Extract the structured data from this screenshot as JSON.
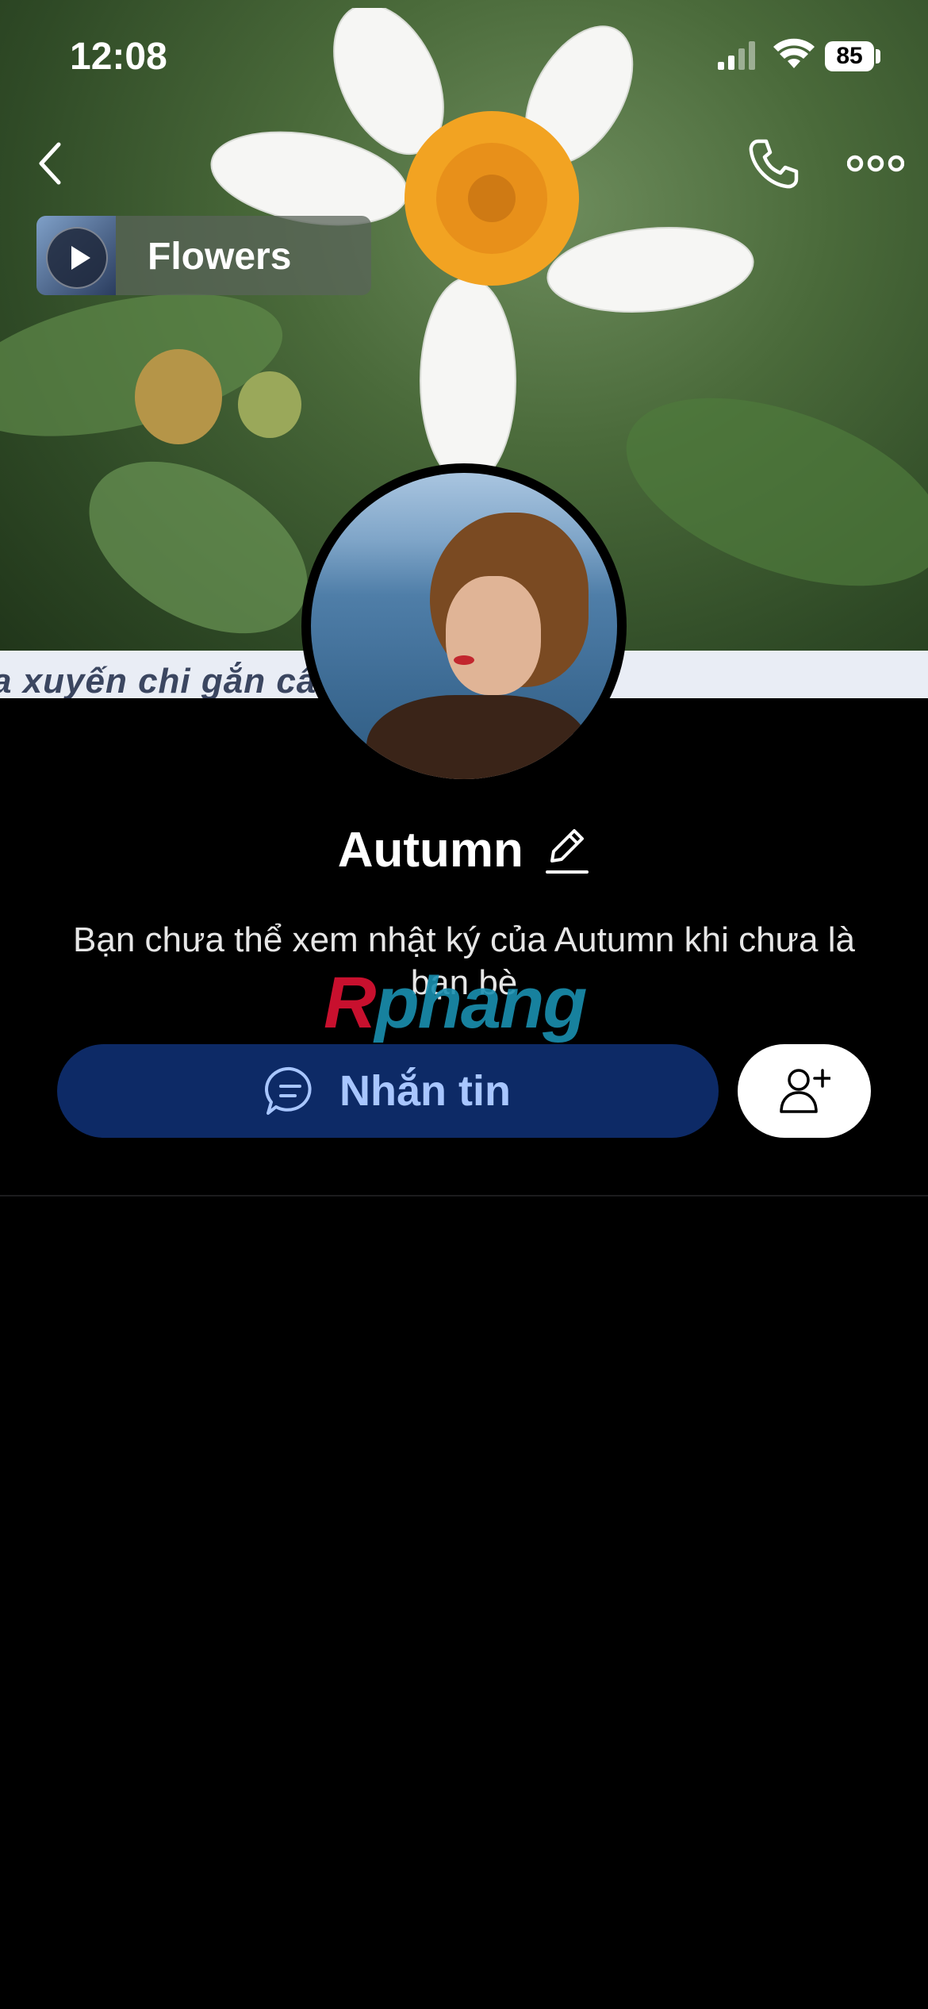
{
  "status_bar": {
    "time": "12:08",
    "battery": "85"
  },
  "cover": {
    "banner_text": "a xuyến chi gắn          câu chuyện bu"
  },
  "music": {
    "title": "Flowers"
  },
  "profile": {
    "name": "Autumn",
    "privacy_notice": "Bạn chưa thể xem nhật ký của Autumn khi chưa là bạn bè"
  },
  "actions": {
    "message_label": "Nhắn tin"
  },
  "watermark": {
    "first": "R",
    "rest": "phang"
  },
  "colors": {
    "message_button_bg": "#0d2a66",
    "message_button_text": "#a8c6ff",
    "background": "#000000"
  },
  "icons": {
    "back": "chevron-left-icon",
    "call": "phone-icon",
    "more": "more-horizontal-icon",
    "play": "play-icon",
    "edit": "pencil-icon",
    "message": "chat-bubble-icon",
    "add_friend": "add-friend-icon"
  }
}
